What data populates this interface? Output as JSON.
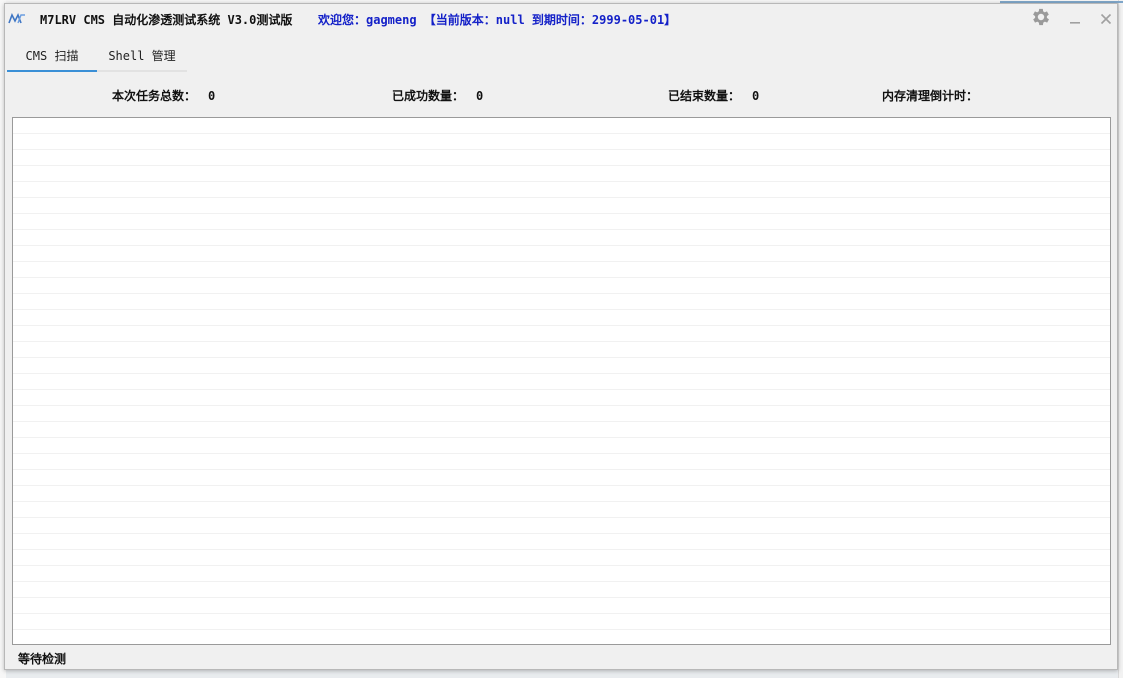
{
  "window": {
    "title": "M7LRV CMS 自动化渗透测试系统 V3.0测试版",
    "welcome": "欢迎您：gagmeng 【当前版本：null  到期时间：2999-05-01】"
  },
  "tabs": [
    {
      "label": "CMS 扫描",
      "active": true
    },
    {
      "label": "Shell 管理",
      "active": false
    }
  ],
  "stats": {
    "total_label": "本次任务总数：",
    "total_value": "0",
    "success_label": "已成功数量：",
    "success_value": "0",
    "finished_label": "已结束数量：",
    "finished_value": "0",
    "countdown_label": "内存清理倒计时："
  },
  "status_bar": {
    "text": "等待检测"
  },
  "icons": {
    "settings": "gear-icon",
    "minimize": "minimize-icon",
    "close": "close-icon",
    "app": "app-logo-icon"
  },
  "colors": {
    "accent": "#3a8fd6",
    "welcome_text": "#1421c8"
  }
}
